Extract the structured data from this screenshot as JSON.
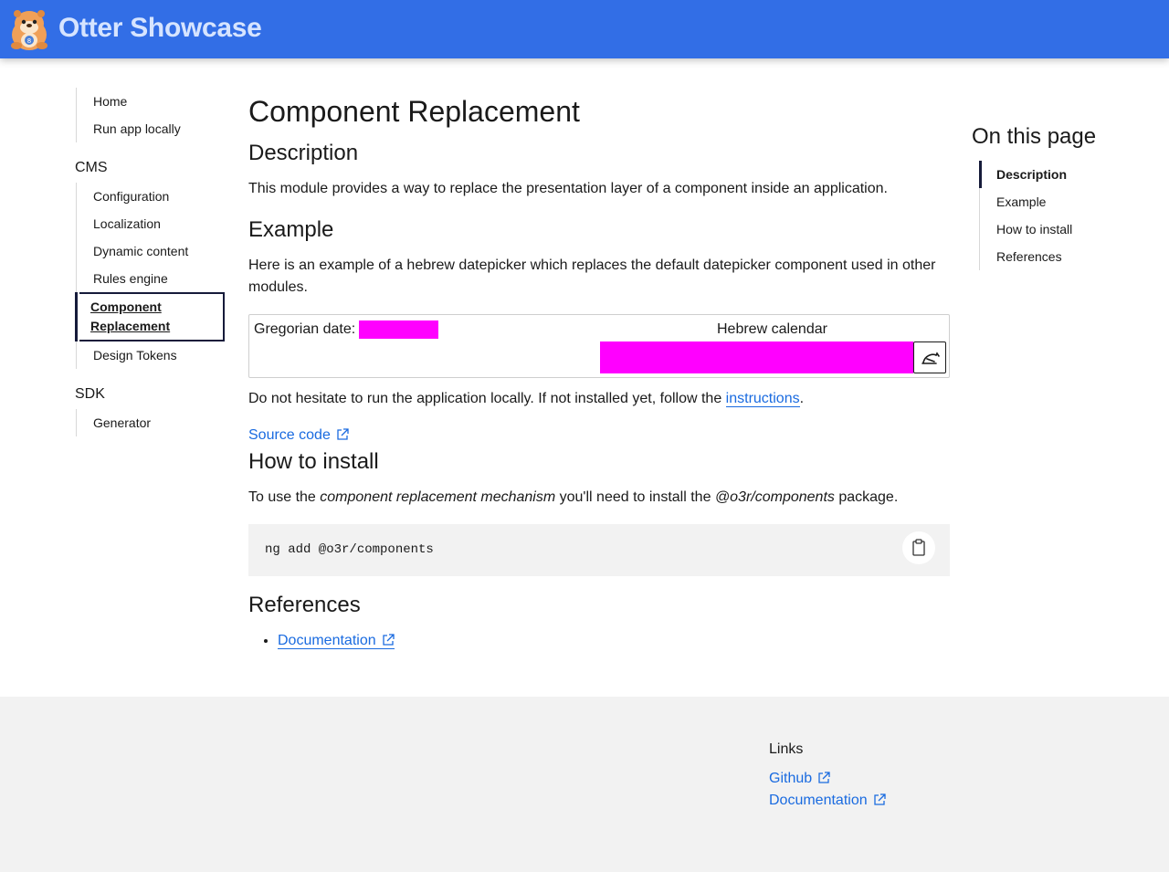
{
  "header": {
    "brand": "Otter Showcase"
  },
  "sidebar": {
    "top_items": [
      "Home",
      "Run app locally"
    ],
    "groups": [
      {
        "title": "CMS",
        "items": [
          "Configuration",
          "Localization",
          "Dynamic content",
          "Rules engine",
          "Component Replacement",
          "Design Tokens"
        ],
        "active": "Component Replacement"
      },
      {
        "title": "SDK",
        "items": [
          "Generator"
        ]
      }
    ]
  },
  "main": {
    "title": "Component Replacement",
    "description": {
      "heading": "Description",
      "text": "This module provides a way to replace the presentation layer of a component inside an application."
    },
    "example": {
      "heading": "Example",
      "text": "Here is an example of a hebrew datepicker which replaces the default datepicker component used in other modules.",
      "gregorian_label": "Gregorian date:",
      "hebrew_label": "Hebrew calendar",
      "run_text_before": "Do not hesitate to run the application locally. If not installed yet, follow the ",
      "run_link": "instructions",
      "run_text_after": ".",
      "source_link": "Source code"
    },
    "install": {
      "heading": "How to install",
      "text_1": "To use the ",
      "text_em1": "component replacement mechanism",
      "text_2": " you'll need to install the ",
      "text_em2": "@o3r/components",
      "text_3": " package.",
      "code": "ng add @o3r/components"
    },
    "references": {
      "heading": "References",
      "items": [
        "Documentation"
      ]
    }
  },
  "toc": {
    "title": "On this page",
    "items": [
      "Description",
      "Example",
      "How to install",
      "References"
    ],
    "active": "Description"
  },
  "footer": {
    "title": "Links",
    "links": [
      "Github",
      "Documentation"
    ]
  },
  "colors": {
    "header": "#326ee6",
    "link": "#1a6be0",
    "placeholder": "#ff00ff",
    "active": "#161b3a"
  }
}
